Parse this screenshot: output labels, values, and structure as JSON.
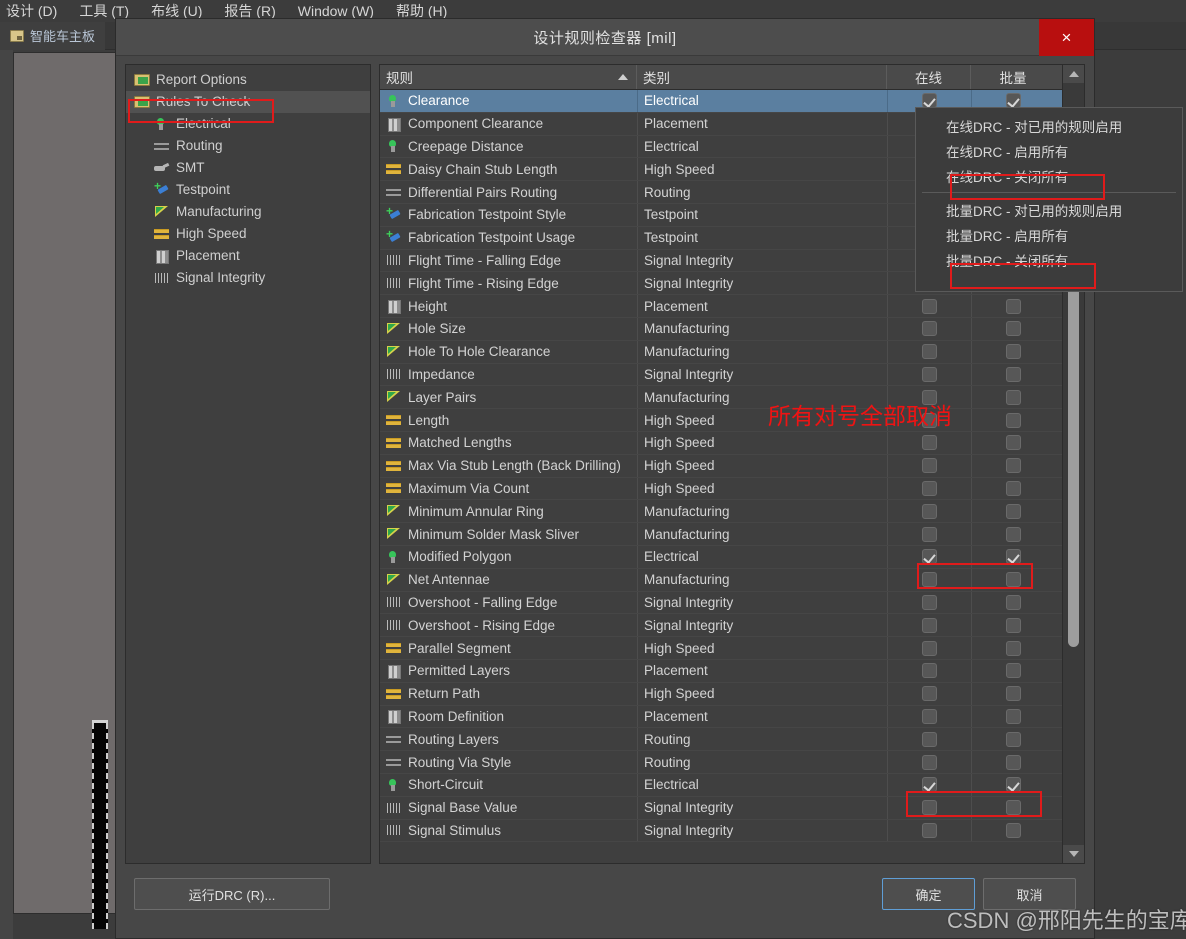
{
  "app": {
    "menubar": [
      {
        "label": "设计 (D)"
      },
      {
        "label": "工具 (T)"
      },
      {
        "label": "布线 (U)"
      },
      {
        "label": "报告 (R)"
      },
      {
        "label": "Window (W)"
      },
      {
        "label": "帮助 (H)"
      }
    ],
    "document_tab": "智能车主板"
  },
  "dialog": {
    "title": "设计规则检查器 [mil]",
    "close_label": "×",
    "tree": [
      {
        "label": "Report Options",
        "icon": "folder-icon",
        "level": 0,
        "selected": false
      },
      {
        "label": "Rules To Check",
        "icon": "folder-icon",
        "level": 0,
        "selected": true
      },
      {
        "label": "Electrical",
        "icon": "electrical-icon",
        "level": 1,
        "selected": false
      },
      {
        "label": "Routing",
        "icon": "routing-icon",
        "level": 1,
        "selected": false
      },
      {
        "label": "SMT",
        "icon": "smt-icon",
        "level": 1,
        "selected": false
      },
      {
        "label": "Testpoint",
        "icon": "testpoint-icon",
        "level": 1,
        "selected": false
      },
      {
        "label": "Manufacturing",
        "icon": "manufacturing-icon",
        "level": 1,
        "selected": false
      },
      {
        "label": "High Speed",
        "icon": "high-speed-icon",
        "level": 1,
        "selected": false
      },
      {
        "label": "Placement",
        "icon": "placement-icon",
        "level": 1,
        "selected": false
      },
      {
        "label": "Signal Integrity",
        "icon": "signal-integrity-icon",
        "level": 1,
        "selected": false
      }
    ],
    "table": {
      "columns": [
        "规则",
        "类别",
        "在线",
        "批量"
      ],
      "sort_column": "规则",
      "sort_direction": "asc",
      "rows": [
        {
          "rule": "Clearance",
          "category": "Electrical",
          "icon": "electrical-icon",
          "online": true,
          "batch": true,
          "selected": true
        },
        {
          "rule": "Component Clearance",
          "category": "Placement",
          "icon": "placement-icon",
          "online": false,
          "batch": false,
          "selected": false
        },
        {
          "rule": "Creepage Distance",
          "category": "Electrical",
          "icon": "electrical-icon",
          "online": false,
          "batch": false,
          "selected": false
        },
        {
          "rule": "Daisy Chain Stub Length",
          "category": "High Speed",
          "icon": "high-speed-icon",
          "online": false,
          "batch": false,
          "selected": false
        },
        {
          "rule": "Differential Pairs Routing",
          "category": "Routing",
          "icon": "routing-icon",
          "online": false,
          "batch": false,
          "selected": false
        },
        {
          "rule": "Fabrication Testpoint Style",
          "category": "Testpoint",
          "icon": "testpoint-icon",
          "online": false,
          "batch": false,
          "selected": false
        },
        {
          "rule": "Fabrication Testpoint Usage",
          "category": "Testpoint",
          "icon": "testpoint-icon",
          "online": false,
          "batch": false,
          "selected": false
        },
        {
          "rule": "Flight Time - Falling Edge",
          "category": "Signal Integrity",
          "icon": "signal-integrity-icon",
          "online": false,
          "batch": false,
          "selected": false
        },
        {
          "rule": "Flight Time - Rising Edge",
          "category": "Signal Integrity",
          "icon": "signal-integrity-icon",
          "online": false,
          "batch": false,
          "selected": false
        },
        {
          "rule": "Height",
          "category": "Placement",
          "icon": "placement-icon",
          "online": false,
          "batch": false,
          "selected": false
        },
        {
          "rule": "Hole Size",
          "category": "Manufacturing",
          "icon": "manufacturing-icon",
          "online": false,
          "batch": false,
          "selected": false
        },
        {
          "rule": "Hole To Hole Clearance",
          "category": "Manufacturing",
          "icon": "manufacturing-icon",
          "online": false,
          "batch": false,
          "selected": false
        },
        {
          "rule": "Impedance",
          "category": "Signal Integrity",
          "icon": "signal-integrity-icon",
          "online": false,
          "batch": false,
          "selected": false
        },
        {
          "rule": "Layer Pairs",
          "category": "Manufacturing",
          "icon": "manufacturing-icon",
          "online": false,
          "batch": false,
          "selected": false
        },
        {
          "rule": "Length",
          "category": "High Speed",
          "icon": "high-speed-icon",
          "online": false,
          "batch": false,
          "selected": false
        },
        {
          "rule": "Matched Lengths",
          "category": "High Speed",
          "icon": "high-speed-icon",
          "online": false,
          "batch": false,
          "selected": false
        },
        {
          "rule": "Max Via Stub Length (Back Drilling)",
          "category": "High Speed",
          "icon": "high-speed-icon",
          "online": false,
          "batch": false,
          "selected": false
        },
        {
          "rule": "Maximum Via Count",
          "category": "High Speed",
          "icon": "high-speed-icon",
          "online": false,
          "batch": false,
          "selected": false
        },
        {
          "rule": "Minimum Annular Ring",
          "category": "Manufacturing",
          "icon": "manufacturing-icon",
          "online": false,
          "batch": false,
          "selected": false
        },
        {
          "rule": "Minimum Solder Mask Sliver",
          "category": "Manufacturing",
          "icon": "manufacturing-icon",
          "online": false,
          "batch": false,
          "selected": false
        },
        {
          "rule": "Modified Polygon",
          "category": "Electrical",
          "icon": "electrical-icon",
          "online": true,
          "batch": true,
          "selected": false
        },
        {
          "rule": "Net Antennae",
          "category": "Manufacturing",
          "icon": "manufacturing-icon",
          "online": false,
          "batch": false,
          "selected": false
        },
        {
          "rule": "Overshoot - Falling Edge",
          "category": "Signal Integrity",
          "icon": "signal-integrity-icon",
          "online": false,
          "batch": false,
          "selected": false
        },
        {
          "rule": "Overshoot - Rising Edge",
          "category": "Signal Integrity",
          "icon": "signal-integrity-icon",
          "online": false,
          "batch": false,
          "selected": false
        },
        {
          "rule": "Parallel Segment",
          "category": "High Speed",
          "icon": "high-speed-icon",
          "online": false,
          "batch": false,
          "selected": false
        },
        {
          "rule": "Permitted Layers",
          "category": "Placement",
          "icon": "placement-icon",
          "online": false,
          "batch": false,
          "selected": false
        },
        {
          "rule": "Return Path",
          "category": "High Speed",
          "icon": "high-speed-icon",
          "online": false,
          "batch": false,
          "selected": false
        },
        {
          "rule": "Room Definition",
          "category": "Placement",
          "icon": "placement-icon",
          "online": false,
          "batch": false,
          "selected": false
        },
        {
          "rule": "Routing Layers",
          "category": "Routing",
          "icon": "routing-icon",
          "online": false,
          "batch": false,
          "selected": false
        },
        {
          "rule": "Routing Via Style",
          "category": "Routing",
          "icon": "routing-icon",
          "online": false,
          "batch": false,
          "selected": false
        },
        {
          "rule": "Short-Circuit",
          "category": "Electrical",
          "icon": "electrical-icon",
          "online": true,
          "batch": true,
          "selected": false
        },
        {
          "rule": "Signal Base Value",
          "category": "Signal Integrity",
          "icon": "signal-integrity-icon",
          "online": false,
          "batch": false,
          "selected": false
        },
        {
          "rule": "Signal Stimulus",
          "category": "Signal Integrity",
          "icon": "signal-integrity-icon",
          "online": false,
          "batch": false,
          "selected": false
        }
      ]
    },
    "context_menu": [
      {
        "label": "在线DRC - 对已用的规则启用",
        "highlighted": false
      },
      {
        "label": "在线DRC - 启用所有",
        "highlighted": false
      },
      {
        "label": "在线DRC - 关闭所有",
        "highlighted": true
      },
      {
        "label": "批量DRC - 对已用的规则启用",
        "highlighted": false
      },
      {
        "label": "批量DRC - 启用所有",
        "highlighted": false
      },
      {
        "label": "批量DRC - 关闭所有",
        "highlighted": true
      }
    ],
    "footer": {
      "run_drc": "运行DRC (R)...",
      "ok": "确定",
      "cancel": "取消"
    }
  },
  "annotations": {
    "note_cancel_all_checks": "所有对号全部取消",
    "accent_red": "#e01b1b"
  },
  "watermark": "CSDN @邢阳先生的宝库"
}
